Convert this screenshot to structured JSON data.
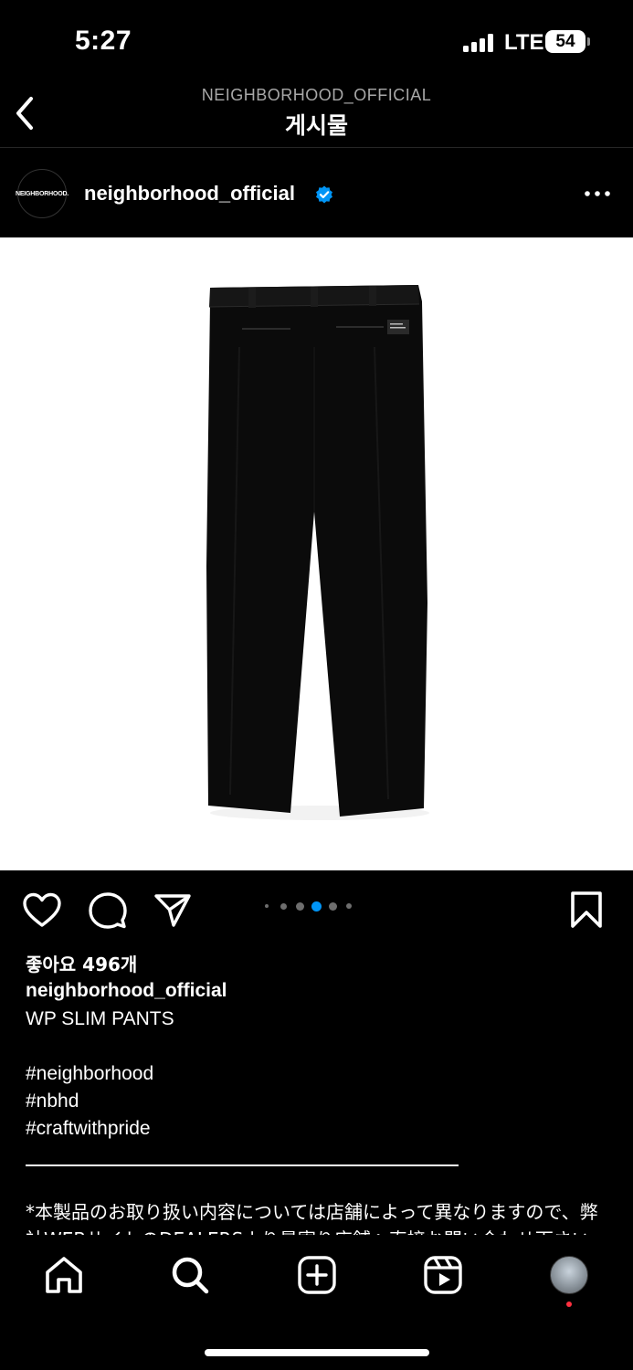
{
  "status_bar": {
    "time": "5:27",
    "network": "LTE",
    "battery": "54"
  },
  "header": {
    "account": "NEIGHBORHOOD_OFFICIAL",
    "title": "게시물"
  },
  "post": {
    "avatar_text": "NEIGHBORHOOD.",
    "username": "neighborhood_official",
    "verified": true,
    "carousel": {
      "count": 5,
      "active_index": 2
    },
    "likes": "좋아요 496개",
    "caption_user": "neighborhood_official",
    "caption_lines": [
      "WP SLIM PANTS",
      "",
      "#neighborhood",
      "#nbhd",
      "#craftwithpride"
    ],
    "jp_text": "*本製品のお取り扱い内容については店舗によって異なりますので、弊社WEBサイトのDEALERSより最寄り店舗へ直接お問い合わせ下さい。"
  },
  "icons": {
    "back": "chevron-left-icon",
    "more": "more-horizontal-icon",
    "verified": "verified-badge-icon",
    "like": "heart-icon",
    "comment": "comment-icon",
    "share": "send-icon",
    "save": "bookmark-icon",
    "home": "home-icon",
    "search": "search-icon",
    "create": "plus-square-icon",
    "reels": "reels-icon",
    "profile": "profile-avatar-icon"
  },
  "colors": {
    "background": "#000000",
    "accent": "#0095f6",
    "secondary_text": "#a8a8a8",
    "notification": "#ff3040"
  }
}
